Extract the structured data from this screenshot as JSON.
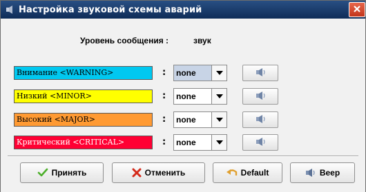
{
  "window": {
    "title": "Настройка звуковой схемы аварий",
    "title_icon": "speaker-icon",
    "close_icon": "close-icon"
  },
  "level": {
    "label": "Уровень сообщения :",
    "value": "звук"
  },
  "alarms": [
    {
      "label": "Внимание <WARNING>",
      "color": "#00c8f0",
      "text_color": "#000000",
      "selected": "none",
      "highlighted": true
    },
    {
      "label": "Низкий <MINOR>",
      "color": "#ffff00",
      "text_color": "#000000",
      "selected": "none",
      "highlighted": false
    },
    {
      "label": "Высокий <MAJOR>",
      "color": "#ff9a33",
      "text_color": "#000000",
      "selected": "none",
      "highlighted": false
    },
    {
      "label": "Критический <CRITICAL>",
      "color": "#ff0033",
      "text_color": "#ffffff",
      "selected": "none",
      "highlighted": false
    }
  ],
  "colon": ":",
  "buttons": {
    "accept": "Принять",
    "cancel": "Отменить",
    "default": "Default",
    "beep": "Beep"
  },
  "colors": {
    "title_bar": "#1a3a6b",
    "close_button": "#d4482c",
    "accept_check": "#4caf2a",
    "cancel_cross": "#d42a1a",
    "speaker": "#7a8fb0"
  }
}
